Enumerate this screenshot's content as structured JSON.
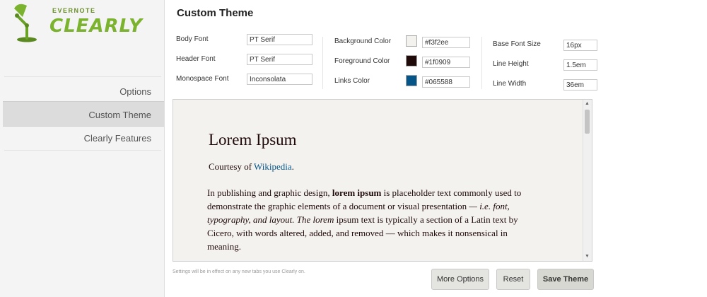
{
  "brand": {
    "top": "EVERNOTE",
    "main": "CLEARLY"
  },
  "sidebar": {
    "items": [
      {
        "label": "Options"
      },
      {
        "label": "Custom Theme"
      },
      {
        "label": "Clearly Features"
      }
    ],
    "active_index": 1
  },
  "page": {
    "title": "Custom Theme"
  },
  "settings": {
    "body_font": {
      "label": "Body Font",
      "value": "PT Serif"
    },
    "header_font": {
      "label": "Header Font",
      "value": "PT Serif"
    },
    "monospace_font": {
      "label": "Monospace Font",
      "value": "Inconsolata"
    },
    "background_color": {
      "label": "Background Color",
      "value": "#f3f2ee",
      "swatch": "#f3f2ee"
    },
    "foreground_color": {
      "label": "Foreground Color",
      "value": "#1f0909",
      "swatch": "#1f0909"
    },
    "links_color": {
      "label": "Links Color",
      "value": "#065588",
      "swatch": "#065588"
    },
    "base_font_size": {
      "label": "Base Font Size",
      "value": "16px"
    },
    "line_height": {
      "label": "Line Height",
      "value": "1.5em"
    },
    "line_width": {
      "label": "Line Width",
      "value": "36em"
    }
  },
  "preview": {
    "title": "Lorem Ipsum",
    "courtesy_prefix": "Courtesy of ",
    "courtesy_link": "Wikipedia",
    "courtesy_suffix": ".",
    "para_1": "In publishing and graphic design, ",
    "para_bold": "lorem ipsum",
    "para_2": " is placeholder text commonly used to demonstrate the graphic elements of a document or visual presentation ",
    "para_italic": "— i.e. font, typography, and layout. The lorem",
    "para_3": " ipsum text is typically a section of a Latin text by Cicero, with words altered, added, and removed — which makes it nonsensical in meaning."
  },
  "footer": {
    "note": "Settings will be in effect on any new tabs you use Clearly on.",
    "more_options": "More Options",
    "reset": "Reset",
    "save_theme": "Save Theme"
  }
}
